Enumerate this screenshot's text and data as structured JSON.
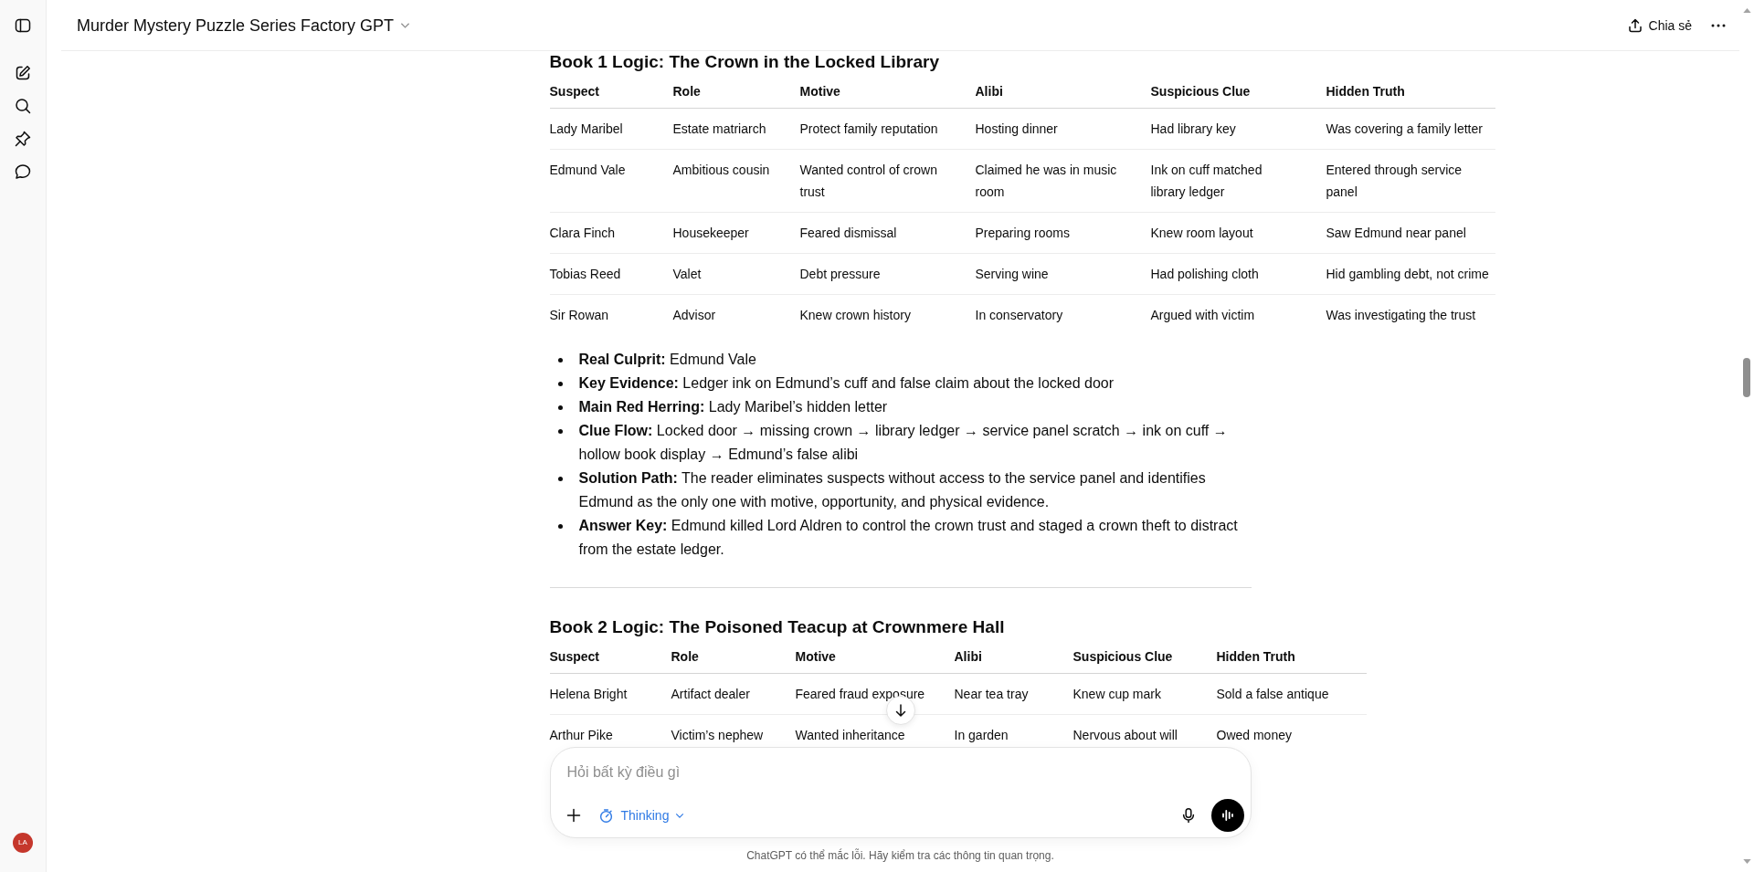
{
  "sidebar": {
    "avatar": "LA"
  },
  "header": {
    "title": "Murder Mystery Puzzle Series Factory GPT",
    "share_label": "Chia sẻ"
  },
  "sections": [
    {
      "heading": "Book 1 Logic: The Crown in the Locked Library",
      "table": {
        "columns": [
          "Suspect",
          "Role",
          "Motive",
          "Alibi",
          "Suspicious Clue",
          "Hidden Truth"
        ],
        "rows": [
          [
            "Lady Maribel",
            "Estate matriarch",
            "Protect family reputation",
            "Hosting dinner",
            "Had library key",
            "Was covering a family letter"
          ],
          [
            "Edmund Vale",
            "Ambitious cousin",
            "Wanted control of crown trust",
            "Claimed he was in music room",
            "Ink on cuff matched library ledger",
            "Entered through service panel"
          ],
          [
            "Clara Finch",
            "Housekeeper",
            "Feared dismissal",
            "Preparing rooms",
            "Knew room layout",
            "Saw Edmund near panel"
          ],
          [
            "Tobias Reed",
            "Valet",
            "Debt pressure",
            "Serving wine",
            "Had polishing cloth",
            "Hid gambling debt, not crime"
          ],
          [
            "Sir Rowan",
            "Advisor",
            "Knew crown history",
            "In conservatory",
            "Argued with victim",
            "Was investigating the trust"
          ]
        ]
      },
      "bullets": [
        "**Real Culprit:** Edmund Vale",
        "**Key Evidence:** Ledger ink on Edmund’s cuff and false claim about the locked door",
        "**Main Red Herring:** Lady Maribel’s hidden letter",
        "**Clue Flow:** Locked door → missing crown → library ledger → service panel scratch → ink on cuff → hollow book display → Edmund’s false alibi",
        "**Solution Path:** The reader eliminates suspects without access to the service panel and identifies Edmund as the only one with motive, opportunity, and physical evidence.",
        "**Answer Key:** Edmund killed Lord Aldren to control the crown trust and staged a crown theft to distract from the estate ledger."
      ]
    },
    {
      "heading": "Book 2 Logic: The Poisoned Teacup at Crownmere Hall",
      "table": {
        "columns": [
          "Suspect",
          "Role",
          "Motive",
          "Alibi",
          "Suspicious Clue",
          "Hidden Truth"
        ],
        "rows": [
          [
            "Helena Bright",
            "Artifact dealer",
            "Feared fraud exposure",
            "Near tea tray",
            "Knew cup mark",
            "Sold a false antique"
          ],
          [
            "Arthur Pike",
            "Victim’s nephew",
            "Wanted inheritance",
            "In garden",
            "Nervous about will",
            "Owed money"
          ]
        ]
      }
    }
  ],
  "composer": {
    "placeholder": "Hỏi bất kỳ điều gì",
    "mode": "Thinking"
  },
  "footer": "ChatGPT có thể mắc lỗi. Hãy kiểm tra các thông tin quan trọng."
}
